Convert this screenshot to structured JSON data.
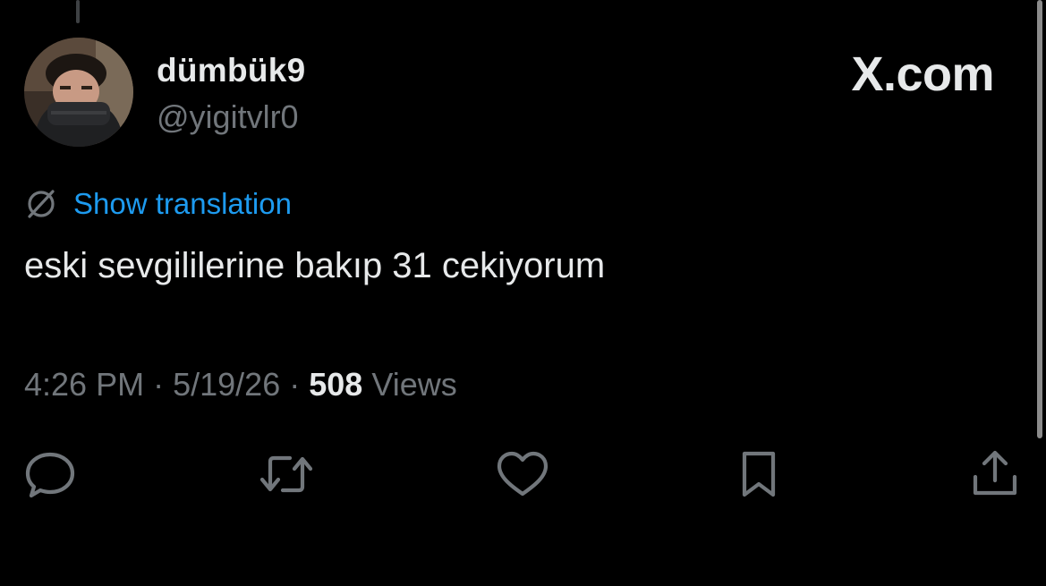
{
  "author": {
    "display_name": "dümbük9",
    "handle": "@yigitvlr0"
  },
  "brand": {
    "label": "X.com"
  },
  "translation": {
    "label": "Show translation",
    "icon": "globe-slash-icon"
  },
  "tweet": {
    "text": "eski sevgililerine bakıp 31 cekiyorum"
  },
  "meta": {
    "time": "4:26 PM",
    "separator": "·",
    "date": "5/19/26",
    "views_count": "508",
    "views_label": "Views"
  },
  "actions": [
    {
      "name": "reply",
      "icon": "reply-icon"
    },
    {
      "name": "repost",
      "icon": "repost-icon"
    },
    {
      "name": "like",
      "icon": "heart-icon"
    },
    {
      "name": "bookmark",
      "icon": "bookmark-icon"
    },
    {
      "name": "share",
      "icon": "share-icon"
    }
  ],
  "colors": {
    "background": "#000000",
    "text_primary": "#e7e9ea",
    "text_secondary": "#71767b",
    "link": "#1d9bf0"
  }
}
